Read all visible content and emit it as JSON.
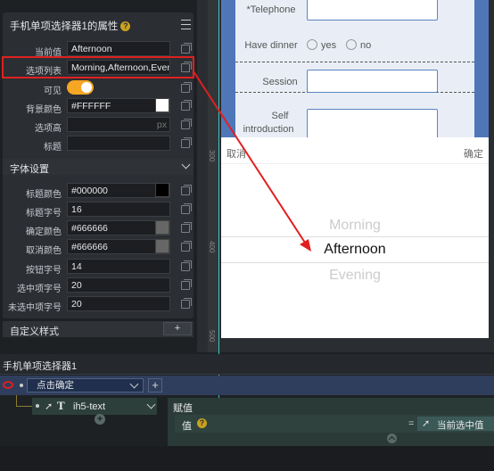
{
  "panel": {
    "title": "手机单项选择器1的属性",
    "rows": [
      {
        "label": "当前值",
        "value": "Afternoon"
      },
      {
        "label": "选项列表",
        "value": "Morning,Afternoon,Evening"
      },
      {
        "label": "可见",
        "toggle": true
      },
      {
        "label": "背景颜色",
        "value": "#FFFFFF",
        "swatch": "#FFFFFF"
      },
      {
        "label": "选项高",
        "value": "",
        "unit": "px"
      },
      {
        "label": "标题",
        "value": ""
      }
    ],
    "font_section": "字体设置",
    "font_rows": [
      {
        "label": "标题颜色",
        "value": "#000000",
        "swatch": "#000000"
      },
      {
        "label": "标题字号",
        "value": "16"
      },
      {
        "label": "确定颜色",
        "value": "#666666",
        "swatch": "#666666"
      },
      {
        "label": "取消颜色",
        "value": "#666666",
        "swatch": "#666666"
      },
      {
        "label": "按钮字号",
        "value": "14"
      },
      {
        "label": "选中项字号",
        "value": "20"
      },
      {
        "label": "未选中项字号",
        "value": "20"
      }
    ],
    "custom_style": "自定义样式",
    "add": "+"
  },
  "form": {
    "telephone": "*Telephone",
    "dinner": "Have dinner",
    "yes": "yes",
    "no": "no",
    "session": "Session",
    "self_intro_1": "Self",
    "self_intro_2": "introduction"
  },
  "picker": {
    "cancel": "取消",
    "confirm": "确定",
    "options": [
      "Morning",
      "Afternoon",
      "Evening"
    ]
  },
  "ruler": {
    "a": "300",
    "b": "400",
    "c": "500"
  },
  "events": {
    "title": "手机单项选择器1",
    "trigger": "点击确定",
    "plus": "+",
    "target": "ih5-text",
    "action": "赋值",
    "value_label": "值",
    "equals": "=",
    "value_source": "当前选中值"
  },
  "colors": {
    "accent": "#f5a623",
    "highlight_box": "#e02020",
    "arrow": "#e02020"
  }
}
